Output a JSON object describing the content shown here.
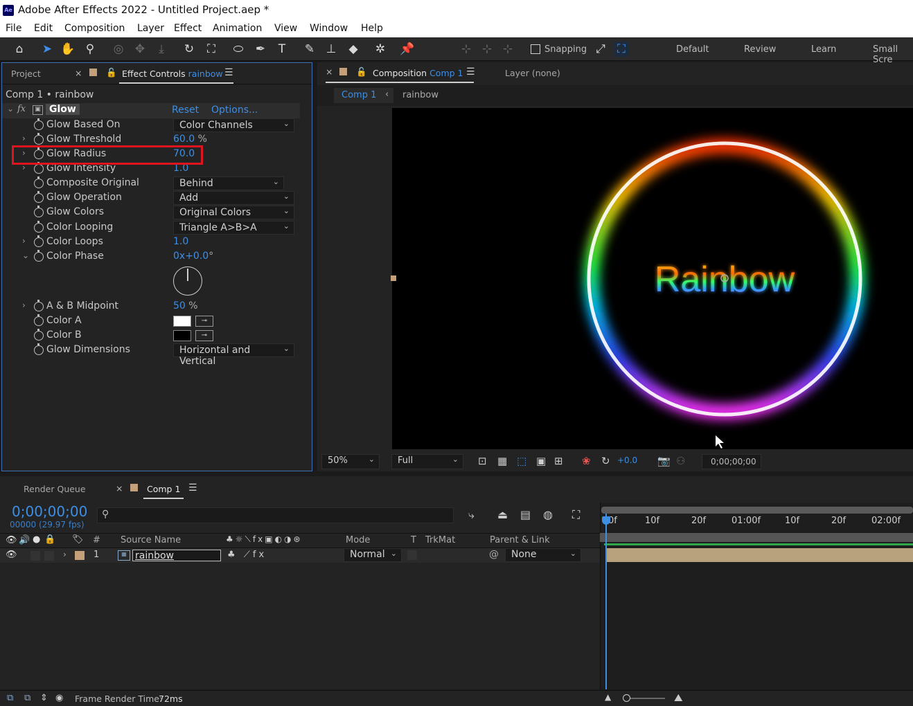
{
  "window": {
    "app_icon": "Ae",
    "title": "Adobe After Effects 2022 - Untitled Project.aep *"
  },
  "menu": [
    "File",
    "Edit",
    "Composition",
    "Layer",
    "Effect",
    "Animation",
    "View",
    "Window",
    "Help"
  ],
  "toolbar": {
    "snapping_label": "Snapping",
    "workspaces": [
      "Default",
      "Review",
      "Learn",
      "Small Scre"
    ],
    "icons": [
      "home-icon",
      "selection-tool-icon",
      "hand-tool-icon",
      "zoom-tool-icon",
      "orbit-camera-icon",
      "pan-camera-icon",
      "dolly-camera-icon",
      "rotation-tool-icon",
      "pan-behind-tool-icon",
      "ellipse-tool-icon",
      "pen-tool-icon",
      "type-tool-icon",
      "brush-tool-icon",
      "clone-stamp-icon",
      "eraser-tool-icon",
      "roto-brush-icon",
      "puppet-pin-icon"
    ]
  },
  "left_panel": {
    "project_tab": "Project",
    "effect_controls_tab": "Effect Controls",
    "effect_controls_layer": "rainbow",
    "breadcrumb": "Comp 1 • rainbow",
    "effect": {
      "fx": "fx",
      "name": "Glow",
      "reset": "Reset",
      "options": "Options..."
    },
    "properties": [
      {
        "name": "Glow Based On",
        "type": "dropdown",
        "value": "Color Channels"
      },
      {
        "name": "Glow Threshold",
        "type": "number",
        "value": "60.0",
        "unit": "%"
      },
      {
        "name": "Glow Radius",
        "type": "number",
        "value": "70.0",
        "unit": ""
      },
      {
        "name": "Glow Intensity",
        "type": "number",
        "value": "1.0",
        "unit": ""
      },
      {
        "name": "Composite Original",
        "type": "dropdown",
        "value": "Behind"
      },
      {
        "name": "Glow Operation",
        "type": "dropdown",
        "value": "Add"
      },
      {
        "name": "Glow Colors",
        "type": "dropdown",
        "value": "Original Colors"
      },
      {
        "name": "Color Looping",
        "type": "dropdown",
        "value": "Triangle A>B>A"
      },
      {
        "name": "Color Loops",
        "type": "number",
        "value": "1.0",
        "unit": ""
      },
      {
        "name": "Color Phase",
        "type": "angle",
        "value": "0x+0.0",
        "unit": "°"
      },
      {
        "name": "A & B Midpoint",
        "type": "number",
        "value": "50",
        "unit": "%"
      },
      {
        "name": "Color A",
        "type": "color",
        "value": "#ffffff"
      },
      {
        "name": "Color B",
        "type": "color",
        "value": "#000000"
      },
      {
        "name": "Glow Dimensions",
        "type": "dropdown",
        "value": "Horizontal and Vertical"
      }
    ],
    "highlight_color": "#e0141e"
  },
  "viewer": {
    "comp_tab": "Composition",
    "comp_tab_name": "Comp 1",
    "layer_tab": "Layer (none)",
    "breadcrumb_comp": "Comp 1",
    "breadcrumb_layer": "rainbow",
    "canvas_text": "Rainbow",
    "footer": {
      "zoom": "50%",
      "resolution": "Full",
      "exposure": "+0.0",
      "timecode": "0;00;00;00"
    }
  },
  "timeline": {
    "render_queue_tab": "Render Queue",
    "comp_tab": "Comp 1",
    "timecode": "0;00;00;00",
    "fps": "00000 (29.97 fps)",
    "columns": {
      "num": "#",
      "source": "Source Name",
      "mode": "Mode",
      "t": "T",
      "trkmat": "TrkMat",
      "parent": "Parent & Link"
    },
    "layer": {
      "index": "1",
      "name": "rainbow",
      "mode": "Normal",
      "parent": "None"
    },
    "ruler": [
      "0f",
      "10f",
      "20f",
      "01:00f",
      "10f",
      "20f",
      "02:00f"
    ]
  },
  "status": {
    "label": "Frame Render Time:",
    "value": "72ms"
  }
}
